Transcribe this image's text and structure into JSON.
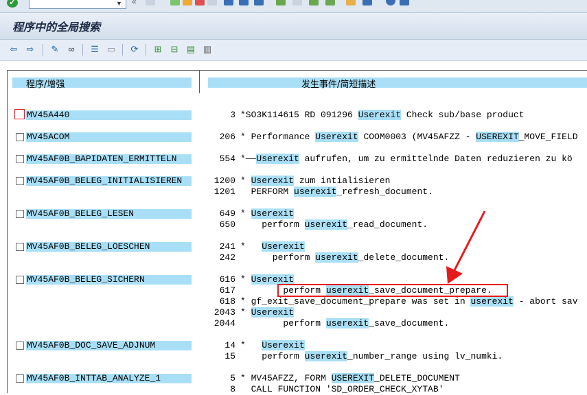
{
  "window": {
    "title": "程序中的全局搜索"
  },
  "columns": {
    "program": "程序/增强",
    "event": "发生事件/简短描述"
  },
  "rows": [
    {
      "program": "MV45A440",
      "focused": true,
      "lines": [
        {
          "num": "3",
          "segs": [
            {
              "t": "*SO3K114615 RD 091296 "
            },
            {
              "t": "Userexit",
              "h": true
            },
            {
              "t": " Check sub/base product"
            }
          ]
        }
      ]
    },
    {
      "program": "MV45ACOM",
      "lines": [
        {
          "num": "206",
          "segs": [
            {
              "t": "* Performance "
            },
            {
              "t": "Userexit",
              "h": true
            },
            {
              "t": " COOM0003 (MV45AFZZ - "
            },
            {
              "t": "USEREXIT",
              "h": true
            },
            {
              "t": "_MOVE_FIELD"
            }
          ]
        }
      ]
    },
    {
      "program": "MV45AF0B_BAPIDATEN_ERMITTELN",
      "lines": [
        {
          "num": "554",
          "segs": [
            {
              "t": "*——"
            },
            {
              "t": "Userexit",
              "h": true
            },
            {
              "t": " aufrufen, um zu ermittelnde Daten reduzieren zu kö"
            }
          ]
        }
      ]
    },
    {
      "program": "MV45AF0B_BELEG_INITIALISIEREN",
      "lines": [
        {
          "num": "1200",
          "segs": [
            {
              "t": "* "
            },
            {
              "t": "Userexit",
              "h": true
            },
            {
              "t": " zum intialisieren"
            }
          ]
        },
        {
          "num": "1201",
          "segs": [
            {
              "t": "  PERFORM "
            },
            {
              "t": "userexit",
              "h": true
            },
            {
              "t": "_refresh_document."
            }
          ]
        }
      ]
    },
    {
      "program": "MV45AF0B_BELEG_LESEN",
      "lines": [
        {
          "num": "649",
          "segs": [
            {
              "t": "* "
            },
            {
              "t": "Userexit",
              "h": true
            }
          ]
        },
        {
          "num": "650",
          "segs": [
            {
              "t": "    perform "
            },
            {
              "t": "userexit",
              "h": true
            },
            {
              "t": "_read_document."
            }
          ]
        }
      ]
    },
    {
      "program": "MV45AF0B_BELEG_LOESCHEN",
      "lines": [
        {
          "num": "241",
          "segs": [
            {
              "t": "*   "
            },
            {
              "t": "Userexit",
              "h": true
            }
          ]
        },
        {
          "num": "242",
          "segs": [
            {
              "t": "      perform "
            },
            {
              "t": "userexit",
              "h": true
            },
            {
              "t": "_delete_document."
            }
          ]
        }
      ]
    },
    {
      "program": "MV45AF0B_BELEG_SICHERN",
      "lines": [
        {
          "num": "616",
          "segs": [
            {
              "t": "* "
            },
            {
              "t": "Userexit",
              "h": true
            }
          ]
        },
        {
          "num": "617",
          "segs": [
            {
              "t": "        perform "
            },
            {
              "t": "userexit",
              "h": true
            },
            {
              "t": "_save_document_prepare."
            }
          ]
        },
        {
          "num": "618",
          "segs": [
            {
              "t": "* gf_exit_save_document_prepare was set in "
            },
            {
              "t": "userexit",
              "h": true
            },
            {
              "t": " - abort sav"
            }
          ]
        },
        {
          "num": "2043",
          "segs": [
            {
              "t": "* "
            },
            {
              "t": "Userexit",
              "h": true
            }
          ]
        },
        {
          "num": "2044",
          "segs": [
            {
              "t": "        perform "
            },
            {
              "t": "userexit",
              "h": true
            },
            {
              "t": "_save_document."
            }
          ]
        }
      ]
    },
    {
      "program": "MV45AF0B_DOC_SAVE_ADJNUM",
      "lines": [
        {
          "num": "14",
          "segs": [
            {
              "t": "*   "
            },
            {
              "t": "Userexit",
              "h": true
            }
          ]
        },
        {
          "num": "15",
          "segs": [
            {
              "t": "    perform "
            },
            {
              "t": "userexit",
              "h": true
            },
            {
              "t": "_number_range using lv_numki."
            }
          ]
        }
      ]
    },
    {
      "program": "MV45AF0B_INTTAB_ANALYZE_1",
      "lines": [
        {
          "num": "5",
          "segs": [
            {
              "t": "* MV45AFZZ, FORM "
            },
            {
              "t": "USEREXIT",
              "h": true
            },
            {
              "t": "_DELETE_DOCUMENT"
            }
          ]
        },
        {
          "num": "8",
          "segs": [
            {
              "t": "  CALL FUNCTION 'SD_ORDER_CHECK_XYTAB'"
            }
          ]
        }
      ]
    }
  ],
  "colors": {
    "highlight": "#a9dff6",
    "annotation": "#e8191b"
  }
}
